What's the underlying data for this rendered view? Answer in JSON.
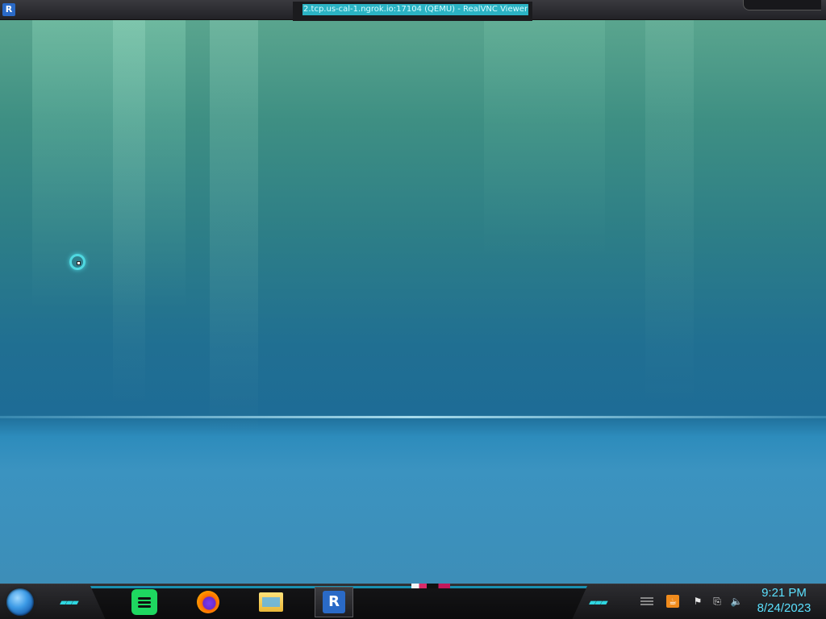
{
  "window": {
    "title": "2.tcp.us-cal-1.ngrok.io:17104 (QEMU) - RealVNC Viewer",
    "app_icon": "realvnc-icon"
  },
  "desktop": {
    "wallpaper": "aurora-underwater",
    "cursor": "busy-cursor"
  },
  "taskbar": {
    "start_button": "windows-start-orb",
    "pinned_apps": [
      {
        "name": "Spotify",
        "icon": "spotify-icon"
      },
      {
        "name": "Firefox",
        "icon": "firefox-icon"
      },
      {
        "name": "File Explorer",
        "icon": "folder-icon"
      },
      {
        "name": "RealVNC Viewer",
        "icon": "realvnc-icon",
        "active": true
      }
    ],
    "tray": {
      "icons": [
        "show-hidden-icon",
        "java-icon",
        "action-center-flag-icon",
        "network-icon",
        "volume-icon"
      ],
      "clock_time": "9:21 PM",
      "clock_date": "8/24/2023"
    }
  },
  "colors": {
    "accent": "#2fd6e0",
    "clock_text": "#5be1ff",
    "title_highlight": "#2bb3c4"
  }
}
